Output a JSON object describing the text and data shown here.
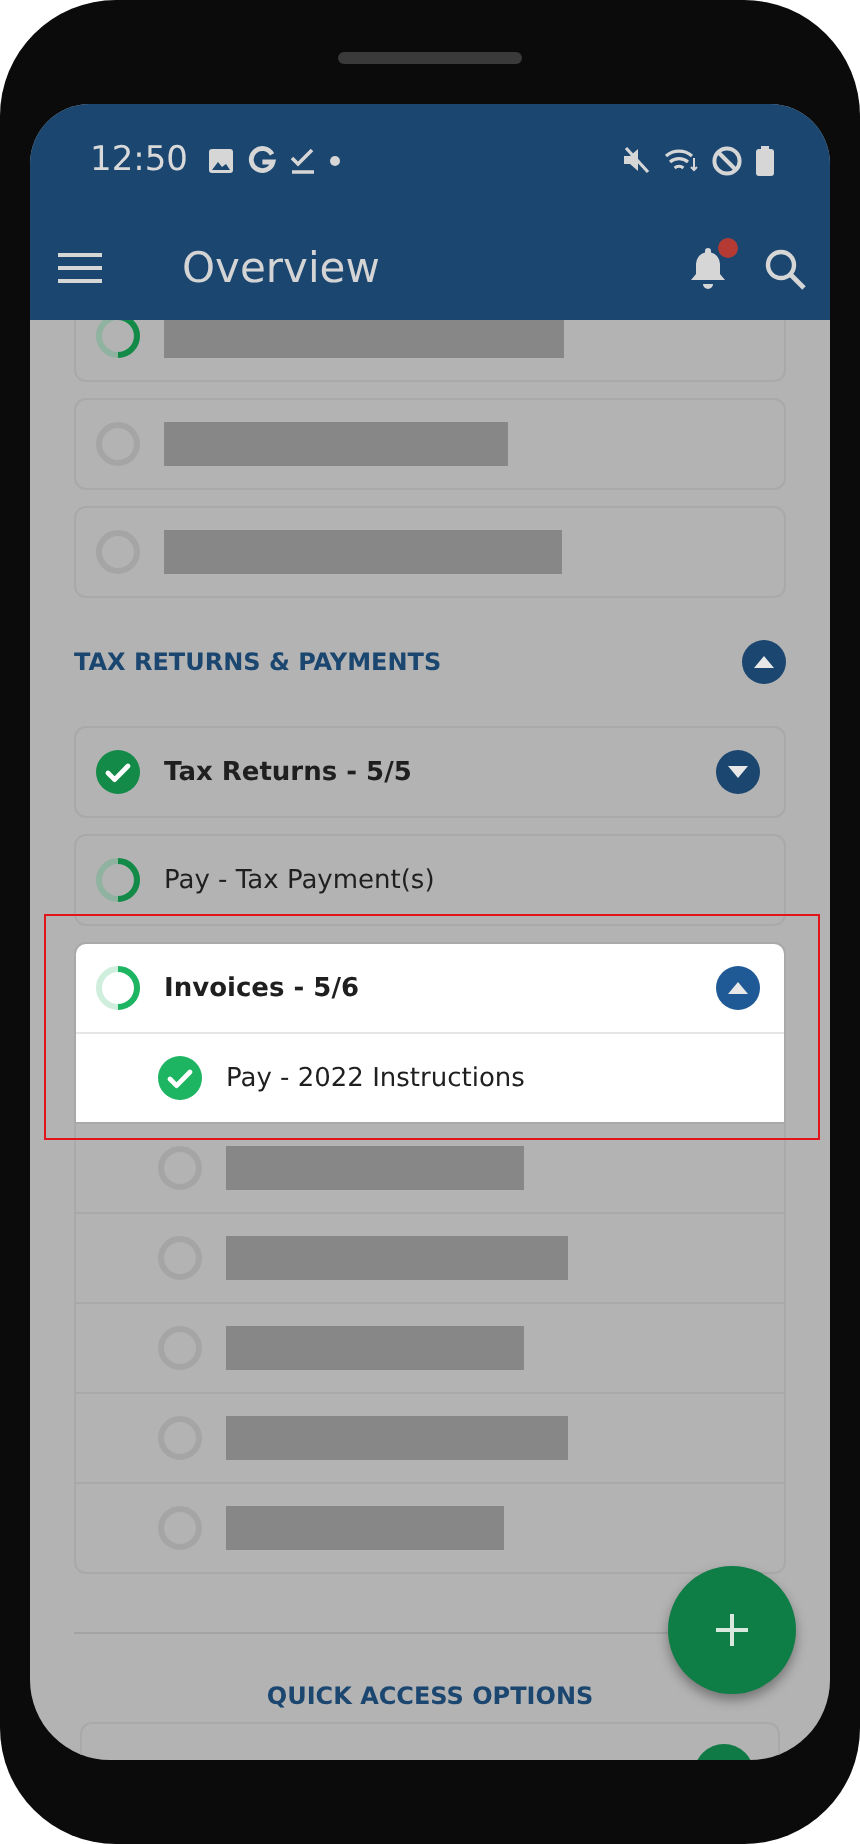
{
  "status_bar": {
    "time": "12:50"
  },
  "app_bar": {
    "title": "Overview",
    "notification_dot": true
  },
  "top_items": [
    {
      "kind": "redacted",
      "started": true,
      "completed": false
    },
    {
      "kind": "redacted",
      "started": false,
      "completed": false
    },
    {
      "kind": "redacted",
      "started": false,
      "completed": false
    }
  ],
  "section": {
    "title": "TAX RETURNS & PAYMENTS",
    "expanded": true
  },
  "tasks": [
    {
      "kind": "group",
      "label": "Tax Returns - 5/5",
      "completed": true,
      "expanded": false,
      "highlighted": false
    },
    {
      "kind": "task",
      "label": "Pay - Tax Payment(s)",
      "started": true,
      "completed": false,
      "highlighted": false
    },
    {
      "kind": "group",
      "label": "Invoices - 5/6",
      "started": true,
      "completed": false,
      "expanded": true,
      "highlighted": true,
      "children": [
        {
          "kind": "task",
          "label": "Pay - 2022 Instructions",
          "completed": true,
          "highlighted": true
        },
        {
          "kind": "redacted",
          "started": false,
          "completed": false,
          "highlighted": false
        },
        {
          "kind": "redacted",
          "started": false,
          "completed": false,
          "highlighted": false
        },
        {
          "kind": "redacted",
          "started": false,
          "completed": false,
          "highlighted": false
        },
        {
          "kind": "redacted",
          "started": false,
          "completed": false,
          "highlighted": false
        },
        {
          "kind": "redacted",
          "started": false,
          "completed": false,
          "highlighted": false
        }
      ]
    }
  ],
  "quick_access": {
    "title": "QUICK ACCESS OPTIONS"
  }
}
